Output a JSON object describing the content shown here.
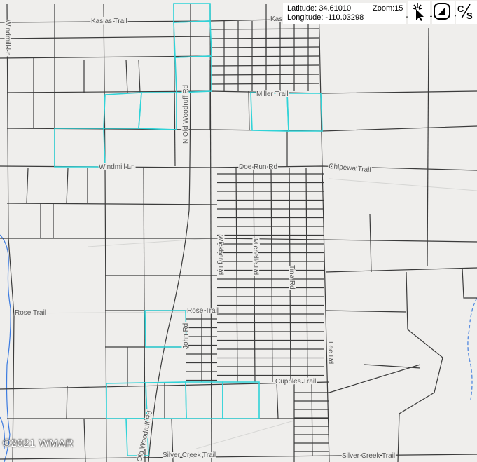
{
  "coordinates": {
    "latitude_label": "Latitude: 34.61010",
    "longitude_label": "Longitude: -110.03298"
  },
  "zoom": {
    "label": "Zoom:15"
  },
  "toolbar": {
    "tools": [
      {
        "icon": "cursor-sparkle-icon"
      },
      {
        "icon": "shape-select-icon"
      },
      {
        "icon": "clear-selection-icon",
        "label": "C/S"
      }
    ]
  },
  "roads": {
    "kasias_trail": "Kasias Trail",
    "kasia_trail_right": "Kasia",
    "windmill_ln_vertical": "Windmill Ln",
    "n_old_woodruff_rd": "N Old Woodruff Rd",
    "miller_trail": "Miller Trail",
    "windmill_ln": "Windmill Ln",
    "doe_run_rd": "Doe Run Rd",
    "chipewa_trail": "Chipewa Trail",
    "wickberg_rd": "Wickberg Rd",
    "michelle_rd": "Michelle Rd",
    "tina_rd": "Tina Rd",
    "rose_trail_left": "Rose Trail",
    "rose_trail": "Rose Trail",
    "john_rd": "John Rd",
    "lee_rd": "Lee Rd",
    "cupples_trail": "Cupples Trail",
    "old_woodruff_rd": "Old Woodruff Rd",
    "silver_creek_trail_left": "Silver Creek Trail",
    "silver_creek_trail_right": "Silver Creek Trail"
  },
  "copyright": "©2021 WMAR",
  "colors": {
    "background": "#efeeec",
    "road": "#3b3b3b",
    "parcel_highlight": "#2fd3d8",
    "water": "#3c7be0"
  }
}
